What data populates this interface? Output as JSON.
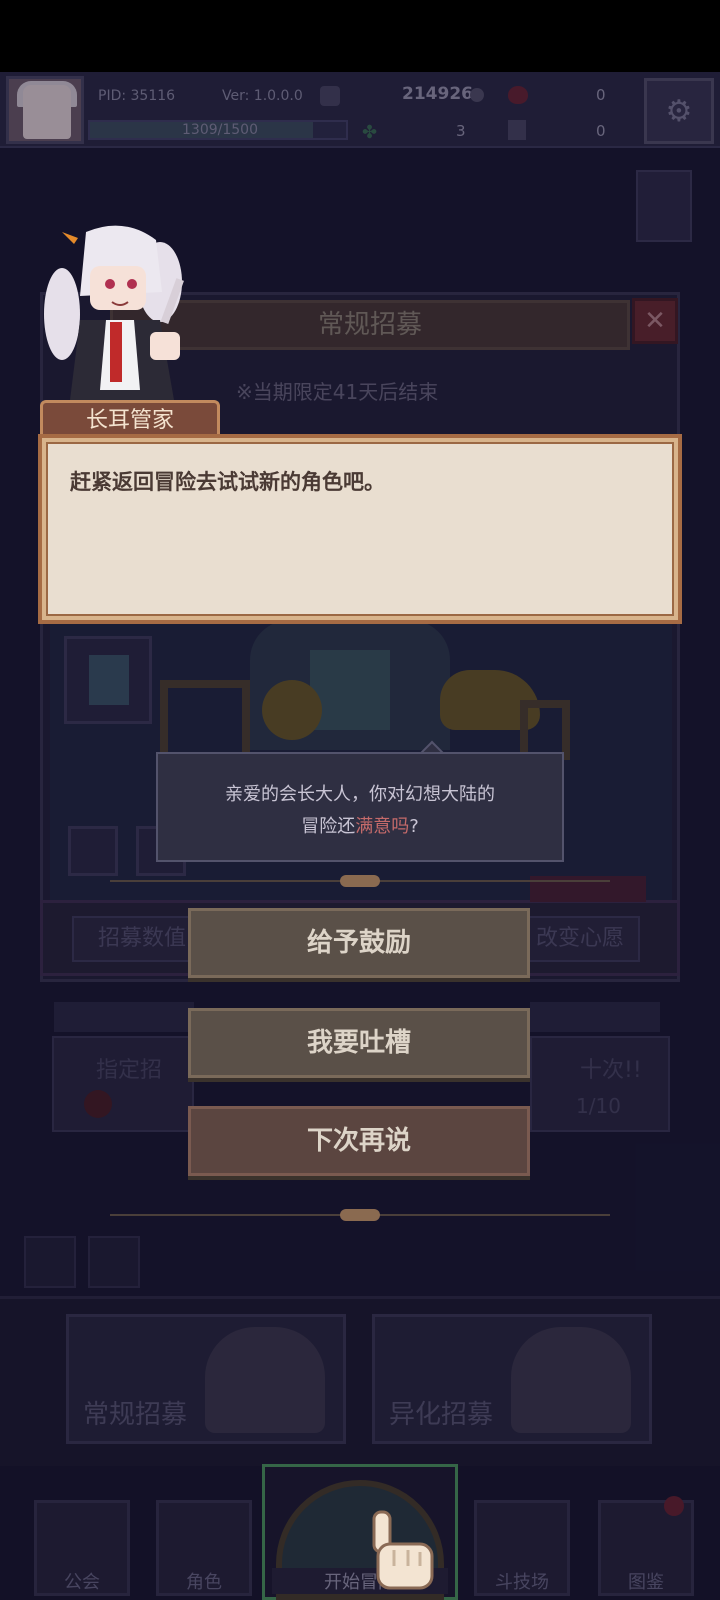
{
  "player": {
    "pid": "PID: 35116",
    "version": "Ver: 1.0.0.0",
    "gold": "214926",
    "hearts": "0",
    "exp": "1309/1500",
    "exp_fraction": 0.873,
    "clovers": "3",
    "boots": "0"
  },
  "recruit_panel": {
    "title": "常规招募",
    "notice": "※当期限定41天后结束",
    "left_button": "招募数值",
    "right_button": "改变心愿",
    "left_card_title": "指定招",
    "right_card_title": "十次!!",
    "right_card_count": "1/10"
  },
  "dialogue": {
    "speaker": "长耳管家",
    "text": "赶紧返回冒险去试试新的角色吧。"
  },
  "question": {
    "line1": "亲爱的会长大人，你对幻想大陆的",
    "line2_prefix": "冒险还",
    "line2_highlight": "满意吗",
    "line2_suffix": "?"
  },
  "choices": [
    {
      "label": "给予鼓励"
    },
    {
      "label": "我要吐槽"
    },
    {
      "label": "下次再说"
    }
  ],
  "cards": {
    "regular": "常规招募",
    "special": "异化招募"
  },
  "nav": {
    "guild": "公会",
    "character": "角色",
    "start": "开始冒险",
    "arena": "斗技场",
    "codex": "图鉴"
  },
  "colors": {
    "dialog_bg": "#e9ded0",
    "dialog_border": "#a66b44",
    "highlight": "#c46a6a",
    "start_border": "#4e9a62"
  }
}
